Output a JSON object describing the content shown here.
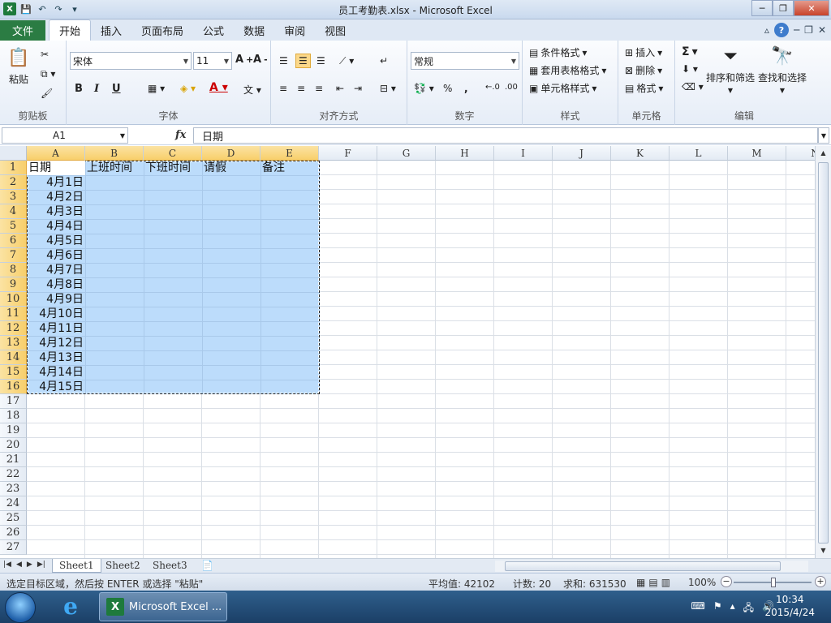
{
  "window": {
    "title": "员工考勤表.xlsx - Microsoft Excel",
    "minimize": "─",
    "restore": "❐",
    "close": "✕"
  },
  "ribbon_tabs": {
    "file": "文件",
    "tabs": [
      "开始",
      "插入",
      "页面布局",
      "公式",
      "数据",
      "审阅",
      "视图"
    ]
  },
  "ribbon": {
    "clipboard": {
      "label": "剪贴板",
      "paste": "粘贴"
    },
    "font": {
      "label": "字体",
      "font_name": "宋体",
      "font_size": "11",
      "bold": "B",
      "italic": "I",
      "underline": "U"
    },
    "alignment": {
      "label": "对齐方式"
    },
    "number": {
      "label": "数字",
      "format": "常规",
      "percent": "%",
      "comma": ","
    },
    "styles": {
      "label": "样式",
      "conditional": "条件格式",
      "table_format": "套用表格格式",
      "cell_styles": "单元格样式"
    },
    "cells": {
      "label": "单元格",
      "insert": "插入",
      "delete": "删除",
      "format": "格式"
    },
    "editing": {
      "label": "编辑",
      "sum": "Σ",
      "sort_filter": "排序和筛选",
      "find_select": "查找和选择"
    }
  },
  "formula_bar": {
    "name_box": "A1",
    "fx": "fx",
    "content": "日期"
  },
  "columns": [
    "A",
    "B",
    "C",
    "D",
    "E",
    "F",
    "G",
    "H",
    "I",
    "J",
    "K",
    "L",
    "M",
    "N"
  ],
  "rows": [
    "1",
    "2",
    "3",
    "4",
    "5",
    "6",
    "7",
    "8",
    "9",
    "10",
    "11",
    "12",
    "13",
    "14",
    "15",
    "16",
    "17",
    "18",
    "19",
    "20",
    "21",
    "22",
    "23",
    "24",
    "25",
    "26",
    "27"
  ],
  "headers": [
    "日期",
    "上班时间",
    "下班时间",
    "请假",
    "备注"
  ],
  "dates": [
    "4月1日",
    "4月2日",
    "4月3日",
    "4月4日",
    "4月5日",
    "4月6日",
    "4月7日",
    "4月8日",
    "4月9日",
    "4月10日",
    "4月11日",
    "4月12日",
    "4月13日",
    "4月14日",
    "4月15日"
  ],
  "sheets": [
    "Sheet1",
    "Sheet2",
    "Sheet3"
  ],
  "status": {
    "message": "选定目标区域，然后按 ENTER 或选择 \"粘贴\"",
    "average": "平均值: 42102",
    "count": "计数: 20",
    "sum": "求和: 631530",
    "zoom": "100%"
  },
  "taskbar": {
    "app_label": "Microsoft Excel ...",
    "time": "10:34",
    "date": "2015/4/24"
  }
}
